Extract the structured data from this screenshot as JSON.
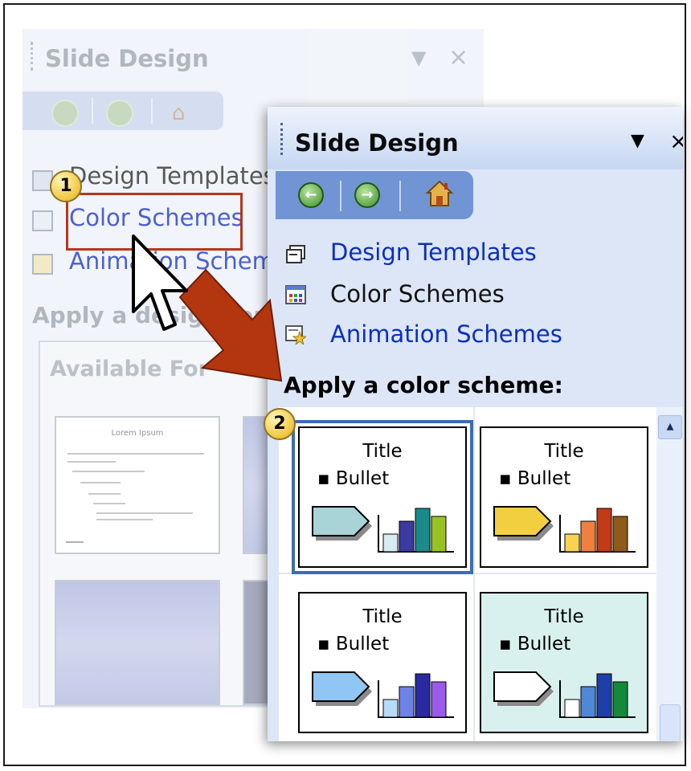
{
  "back_pane": {
    "title": "Slide Design",
    "links": [
      "Design Templates",
      "Color Schemes",
      "Animation Schemes"
    ],
    "section": "Apply a design template:",
    "gallery_label": "Available For",
    "thumb_title": "Lorem Ipsum"
  },
  "front_pane": {
    "title": "Slide Design",
    "controls": {
      "dropdown": "▼",
      "close": "×"
    },
    "links": [
      {
        "label": "Design Templates",
        "icon": "design-templates-icon"
      },
      {
        "label": "Color Schemes",
        "icon": "color-schemes-icon"
      },
      {
        "label": "Animation Schemes",
        "icon": "animation-schemes-icon"
      }
    ],
    "section": "Apply a color scheme:",
    "schemes": [
      {
        "title": "Title",
        "bullet": "Bullet",
        "bg": "#ffffff",
        "shape": "#a8d4d8",
        "bars": [
          "#d5ecf2",
          "#3a3aa0",
          "#1a8a8a",
          "#98c222"
        ],
        "selected": true
      },
      {
        "title": "Title",
        "bullet": "Bullet",
        "bg": "#ffffff",
        "shape": "#f2cf3f",
        "bars": [
          "#f6d452",
          "#f08040",
          "#c23a18",
          "#8e5c16"
        ],
        "selected": false
      },
      {
        "title": "Title",
        "bullet": "Bullet",
        "bg": "#ffffff",
        "shape": "#8fc6f3",
        "bars": [
          "#b7dbf7",
          "#6d83e6",
          "#2a2aa0",
          "#9a5be8"
        ],
        "selected": false
      },
      {
        "title": "Title",
        "bullet": "Bullet",
        "bg": "#d9f1ee",
        "shape": "#ffffff",
        "bars": [
          "#ffffff",
          "#4f88d8",
          "#1f3fa8",
          "#128a3a"
        ],
        "selected": false
      }
    ]
  },
  "callouts": [
    "1",
    "2"
  ],
  "colors": {
    "highlight": "#b6371b",
    "arrow": "#b3360f",
    "link": "#0b2ec0"
  }
}
